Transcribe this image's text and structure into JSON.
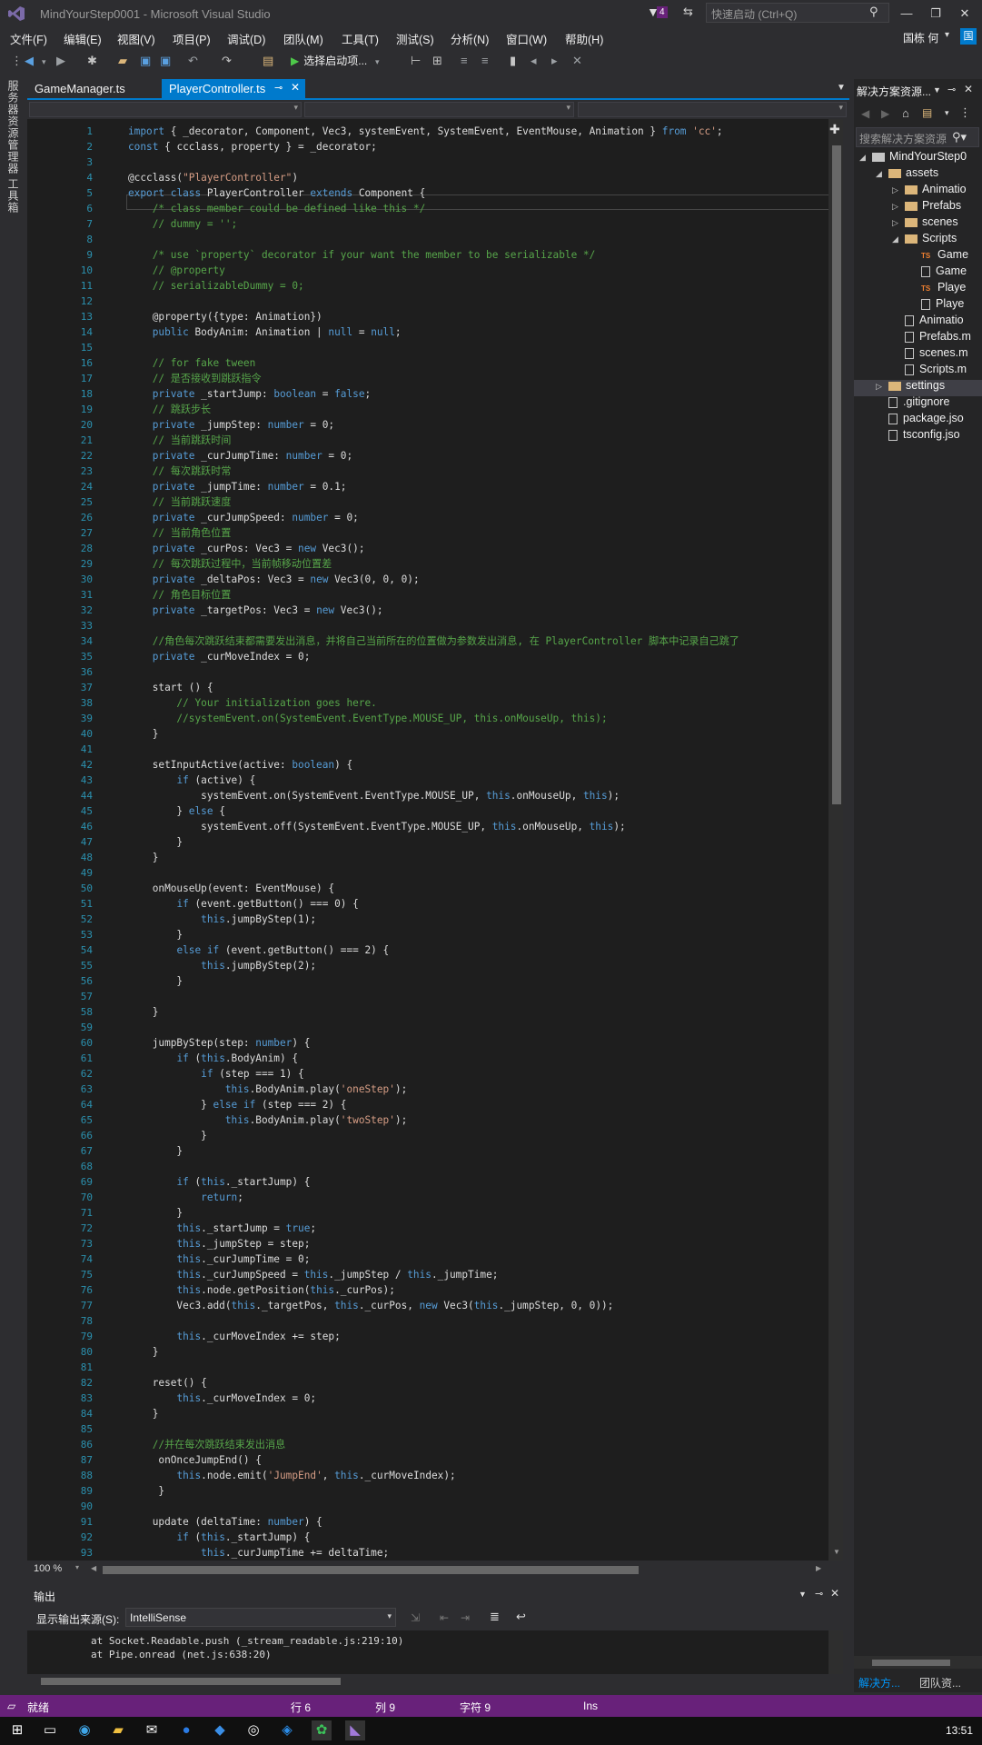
{
  "window": {
    "title": "MindYourStep0001 - Microsoft Visual Studio",
    "notification_count": "4",
    "quick_launch_placeholder": "快速启动 (Ctrl+Q)",
    "controls": {
      "minimize": "—",
      "restore": "❐",
      "close": "✕"
    }
  },
  "menu": [
    "文件(F)",
    "编辑(E)",
    "视图(V)",
    "项目(P)",
    "调试(D)",
    "团队(M)",
    "工具(T)",
    "测试(S)",
    "分析(N)",
    "窗口(W)",
    "帮助(H)"
  ],
  "user": {
    "name": "国栋 何",
    "badge": "国"
  },
  "toolbar": {
    "start_label": "选择启动项..."
  },
  "left_tabs": [
    "服务器资源管理器",
    "工具箱"
  ],
  "tabs": [
    {
      "label": "GameManager.ts",
      "active": false
    },
    {
      "label": "PlayerController.ts",
      "active": true
    }
  ],
  "editor": {
    "zoom": "100 %",
    "lines": [
      {
        "n": "1",
        "t": "import { _decorator, Component, Vec3, systemEvent, SystemEvent, EventMouse, Animation } from 'cc';"
      },
      {
        "n": "2",
        "t": "const { ccclass, property } = _decorator;"
      },
      {
        "n": "3",
        "t": ""
      },
      {
        "n": "4",
        "t": "@ccclass(\"PlayerController\")"
      },
      {
        "n": "5",
        "t": "export class PlayerController extends Component {"
      },
      {
        "n": "6",
        "t": "    /* class member could be defined like this */"
      },
      {
        "n": "7",
        "t": "    // dummy = '';"
      },
      {
        "n": "8",
        "t": ""
      },
      {
        "n": "9",
        "t": "    /* use `property` decorator if your want the member to be serializable */"
      },
      {
        "n": "10",
        "t": "    // @property"
      },
      {
        "n": "11",
        "t": "    // serializableDummy = 0;"
      },
      {
        "n": "12",
        "t": ""
      },
      {
        "n": "13",
        "t": "    @property({type: Animation})"
      },
      {
        "n": "14",
        "t": "    public BodyAnim: Animation | null = null;"
      },
      {
        "n": "15",
        "t": ""
      },
      {
        "n": "16",
        "t": "    // for fake tween"
      },
      {
        "n": "17",
        "t": "    // 是否接收到跳跃指令"
      },
      {
        "n": "18",
        "t": "    private _startJump: boolean = false;"
      },
      {
        "n": "19",
        "t": "    // 跳跃步长"
      },
      {
        "n": "20",
        "t": "    private _jumpStep: number = 0;"
      },
      {
        "n": "21",
        "t": "    // 当前跳跃时间"
      },
      {
        "n": "22",
        "t": "    private _curJumpTime: number = 0;"
      },
      {
        "n": "23",
        "t": "    // 每次跳跃时常"
      },
      {
        "n": "24",
        "t": "    private _jumpTime: number = 0.1;"
      },
      {
        "n": "25",
        "t": "    // 当前跳跃速度"
      },
      {
        "n": "26",
        "t": "    private _curJumpSpeed: number = 0;"
      },
      {
        "n": "27",
        "t": "    // 当前角色位置"
      },
      {
        "n": "28",
        "t": "    private _curPos: Vec3 = new Vec3();"
      },
      {
        "n": "29",
        "t": "    // 每次跳跃过程中，当前帧移动位置差"
      },
      {
        "n": "30",
        "t": "    private _deltaPos: Vec3 = new Vec3(0, 0, 0);"
      },
      {
        "n": "31",
        "t": "    // 角色目标位置"
      },
      {
        "n": "32",
        "t": "    private _targetPos: Vec3 = new Vec3();"
      },
      {
        "n": "33",
        "t": ""
      },
      {
        "n": "34",
        "t": "    //角色每次跳跃结束都需要发出消息，并将自己当前所在的位置做为参数发出消息, 在 PlayerController 脚本中记录自己跳了"
      },
      {
        "n": "35",
        "t": "    private _curMoveIndex = 0;"
      },
      {
        "n": "36",
        "t": ""
      },
      {
        "n": "37",
        "t": "    start () {"
      },
      {
        "n": "38",
        "t": "        // Your initialization goes here."
      },
      {
        "n": "39",
        "t": "        //systemEvent.on(SystemEvent.EventType.MOUSE_UP, this.onMouseUp, this);"
      },
      {
        "n": "40",
        "t": "    }"
      },
      {
        "n": "41",
        "t": ""
      },
      {
        "n": "42",
        "t": "    setInputActive(active: boolean) {"
      },
      {
        "n": "43",
        "t": "        if (active) {"
      },
      {
        "n": "44",
        "t": "            systemEvent.on(SystemEvent.EventType.MOUSE_UP, this.onMouseUp, this);"
      },
      {
        "n": "45",
        "t": "        } else {"
      },
      {
        "n": "46",
        "t": "            systemEvent.off(SystemEvent.EventType.MOUSE_UP, this.onMouseUp, this);"
      },
      {
        "n": "47",
        "t": "        }"
      },
      {
        "n": "48",
        "t": "    }"
      },
      {
        "n": "49",
        "t": ""
      },
      {
        "n": "50",
        "t": "    onMouseUp(event: EventMouse) {"
      },
      {
        "n": "51",
        "t": "        if (event.getButton() === 0) {"
      },
      {
        "n": "52",
        "t": "            this.jumpByStep(1);"
      },
      {
        "n": "53",
        "t": "        }"
      },
      {
        "n": "54",
        "t": "        else if (event.getButton() === 2) {"
      },
      {
        "n": "55",
        "t": "            this.jumpByStep(2);"
      },
      {
        "n": "56",
        "t": "        }"
      },
      {
        "n": "57",
        "t": ""
      },
      {
        "n": "58",
        "t": "    }"
      },
      {
        "n": "59",
        "t": ""
      },
      {
        "n": "60",
        "t": "    jumpByStep(step: number) {"
      },
      {
        "n": "61",
        "t": "        if (this.BodyAnim) {"
      },
      {
        "n": "62",
        "t": "            if (step === 1) {"
      },
      {
        "n": "63",
        "t": "                this.BodyAnim.play('oneStep');"
      },
      {
        "n": "64",
        "t": "            } else if (step === 2) {"
      },
      {
        "n": "65",
        "t": "                this.BodyAnim.play('twoStep');"
      },
      {
        "n": "66",
        "t": "            }"
      },
      {
        "n": "67",
        "t": "        }"
      },
      {
        "n": "68",
        "t": ""
      },
      {
        "n": "69",
        "t": "        if (this._startJump) {"
      },
      {
        "n": "70",
        "t": "            return;"
      },
      {
        "n": "71",
        "t": "        }"
      },
      {
        "n": "72",
        "t": "        this._startJump = true;"
      },
      {
        "n": "73",
        "t": "        this._jumpStep = step;"
      },
      {
        "n": "74",
        "t": "        this._curJumpTime = 0;"
      },
      {
        "n": "75",
        "t": "        this._curJumpSpeed = this._jumpStep / this._jumpTime;"
      },
      {
        "n": "76",
        "t": "        this.node.getPosition(this._curPos);"
      },
      {
        "n": "77",
        "t": "        Vec3.add(this._targetPos, this._curPos, new Vec3(this._jumpStep, 0, 0));"
      },
      {
        "n": "78",
        "t": ""
      },
      {
        "n": "79",
        "t": "        this._curMoveIndex += step;"
      },
      {
        "n": "80",
        "t": "    }"
      },
      {
        "n": "81",
        "t": ""
      },
      {
        "n": "82",
        "t": "    reset() {"
      },
      {
        "n": "83",
        "t": "        this._curMoveIndex = 0;"
      },
      {
        "n": "84",
        "t": "    }"
      },
      {
        "n": "85",
        "t": ""
      },
      {
        "n": "86",
        "t": "    //并在每次跳跃结束发出消息"
      },
      {
        "n": "87",
        "t": "     onOnceJumpEnd() {"
      },
      {
        "n": "88",
        "t": "        this.node.emit('JumpEnd', this._curMoveIndex);"
      },
      {
        "n": "89",
        "t": "     }"
      },
      {
        "n": "90",
        "t": ""
      },
      {
        "n": "91",
        "t": "    update (deltaTime: number) {"
      },
      {
        "n": "92",
        "t": "        if (this._startJump) {"
      },
      {
        "n": "93",
        "t": "            this._curJumpTime += deltaTime;"
      }
    ]
  },
  "output": {
    "title": "输出",
    "source_label": "显示输出来源(S):",
    "source_value": "IntelliSense",
    "lines": [
      "at Socket.Readable.push (_stream_readable.js:219:10)",
      "at Pipe.onread (net.js:638:20)"
    ]
  },
  "solution": {
    "title": "解决方案资源...",
    "search_placeholder": "搜索解决方案资源",
    "items": [
      {
        "label": "MindYourStep0",
        "kind": "project",
        "depth": 0,
        "expander": "open"
      },
      {
        "label": "assets",
        "kind": "folder",
        "depth": 1,
        "expander": "open"
      },
      {
        "label": "Animatio",
        "kind": "folder",
        "depth": 2,
        "expander": "closed"
      },
      {
        "label": "Prefabs",
        "kind": "folder",
        "depth": 2,
        "expander": "closed"
      },
      {
        "label": "scenes",
        "kind": "folder",
        "depth": 2,
        "expander": "closed"
      },
      {
        "label": "Scripts",
        "kind": "folder",
        "depth": 2,
        "expander": "open"
      },
      {
        "label": "Game",
        "kind": "ts",
        "depth": 3,
        "expander": "none"
      },
      {
        "label": "Game",
        "kind": "file",
        "depth": 3,
        "expander": "none"
      },
      {
        "label": "Playe",
        "kind": "ts",
        "depth": 3,
        "expander": "none"
      },
      {
        "label": "Playe",
        "kind": "file",
        "depth": 3,
        "expander": "none"
      },
      {
        "label": "Animatio",
        "kind": "file",
        "depth": 2,
        "expander": "none"
      },
      {
        "label": "Prefabs.m",
        "kind": "file",
        "depth": 2,
        "expander": "none"
      },
      {
        "label": "scenes.m",
        "kind": "file",
        "depth": 2,
        "expander": "none"
      },
      {
        "label": "Scripts.m",
        "kind": "file",
        "depth": 2,
        "expander": "none"
      },
      {
        "label": "settings",
        "kind": "folder",
        "depth": 1,
        "expander": "closed"
      },
      {
        "label": ".gitignore",
        "kind": "file",
        "depth": 1,
        "expander": "none"
      },
      {
        "label": "package.jso",
        "kind": "file",
        "depth": 1,
        "expander": "none"
      },
      {
        "label": "tsconfig.jso",
        "kind": "file",
        "depth": 1,
        "expander": "none"
      }
    ],
    "tab_solution": "解决方...",
    "tab_team": "团队资..."
  },
  "status": {
    "ready": "就绪",
    "line": "行 6",
    "col": "列 9",
    "char": "字符 9",
    "mode": "Ins"
  },
  "taskbar": {
    "time": "13:51"
  },
  "colors": {
    "accent": "#007acc",
    "status_bar": "#68217a",
    "keyword": "#569cd6",
    "comment": "#57a64a",
    "string": "#d69d85"
  }
}
